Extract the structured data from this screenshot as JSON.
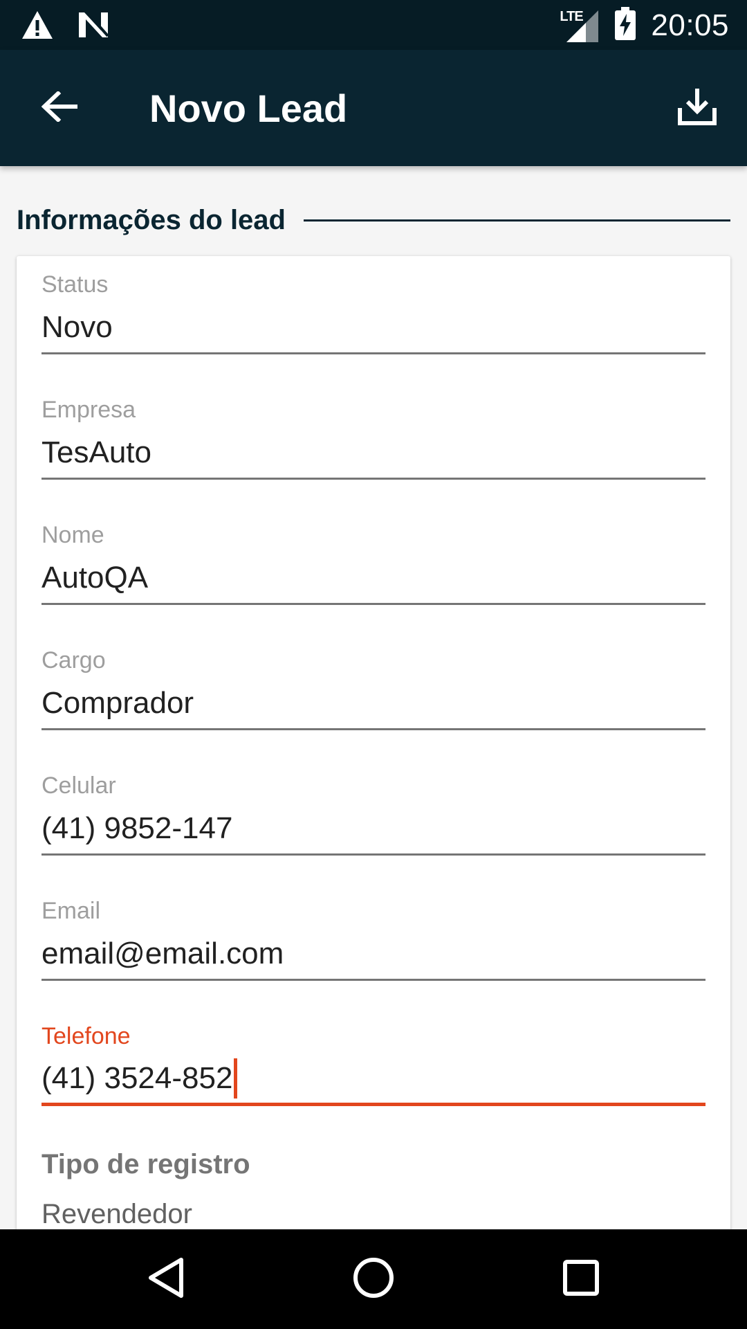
{
  "status_bar": {
    "time": "20:05",
    "network_label": "LTE",
    "icons": [
      "warning-icon",
      "n-notification-icon",
      "lte-signal-icon",
      "battery-charging-icon"
    ]
  },
  "app_bar": {
    "title": "Novo Lead",
    "back_icon": "arrow-left-icon",
    "save_icon": "download-icon"
  },
  "section": {
    "title": "Informações do lead"
  },
  "fields": [
    {
      "label": "Status",
      "value": "Novo"
    },
    {
      "label": "Empresa",
      "value": "TesAuto"
    },
    {
      "label": "Nome",
      "value": "AutoQA"
    },
    {
      "label": "Cargo",
      "value": "Comprador"
    },
    {
      "label": "Celular",
      "value": "(41) 9852-147"
    },
    {
      "label": "Email",
      "value": "email@email.com"
    },
    {
      "label": "Telefone",
      "value": "(41) 3524-852"
    }
  ],
  "record_type": {
    "label": "Tipo de registro",
    "value": "Revendedor"
  },
  "colors": {
    "app_bar": "#0a2531",
    "status_bar": "#061c25",
    "accent": "#e2461d"
  },
  "nav_bar": {
    "icons": [
      "back-triangle-icon",
      "home-circle-icon",
      "recents-square-icon"
    ]
  }
}
